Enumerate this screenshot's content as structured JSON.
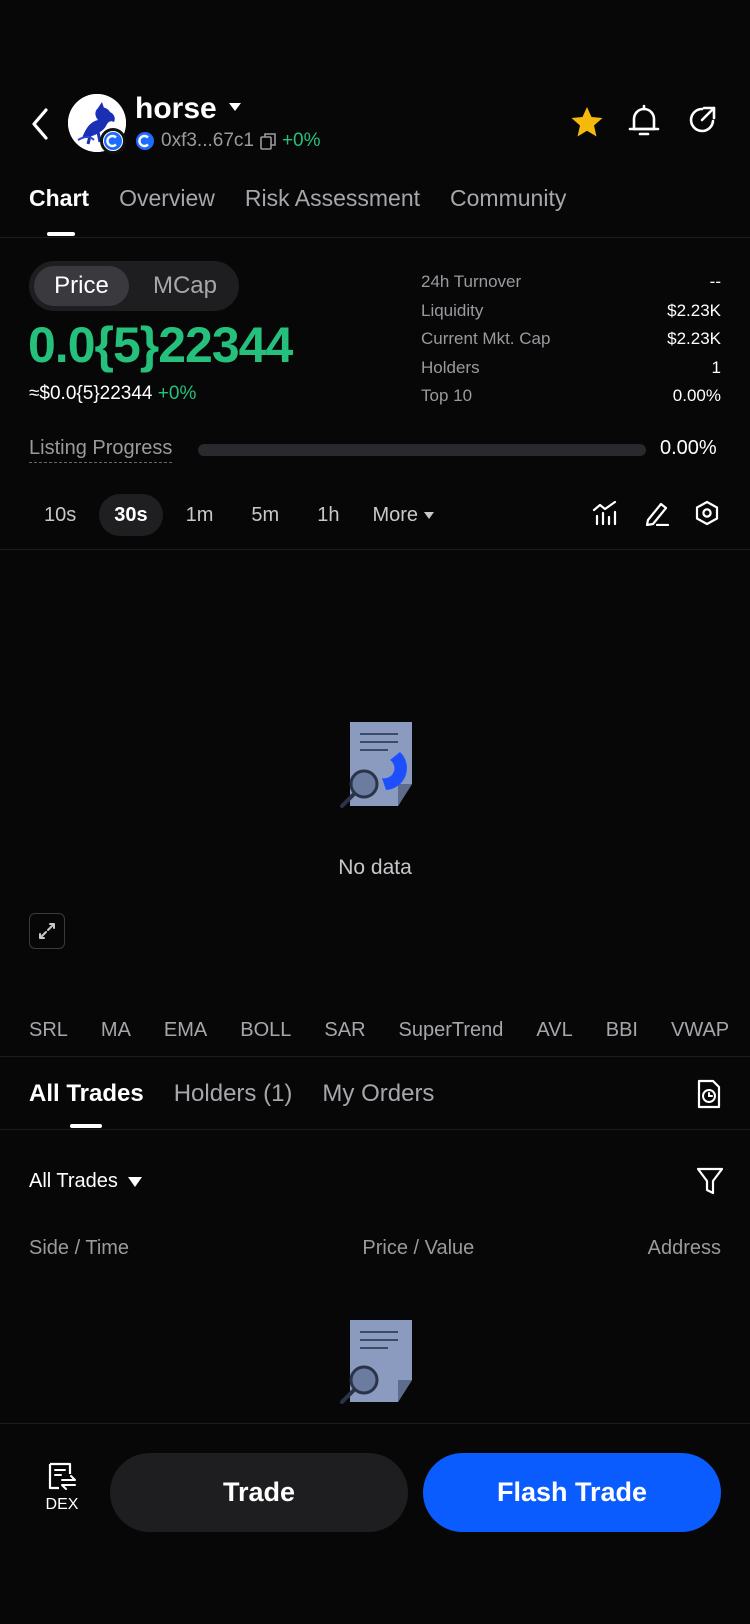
{
  "header": {
    "token_name": "horse",
    "address": "0xf3...67c1",
    "change": "+0%"
  },
  "tabs": [
    {
      "label": "Chart",
      "active": true
    },
    {
      "label": "Overview",
      "active": false
    },
    {
      "label": "Risk Assessment",
      "active": false
    },
    {
      "label": "Community",
      "active": false
    }
  ],
  "price": {
    "toggle": [
      "Price",
      "MCap"
    ],
    "value": "0.0{5}22344",
    "usd_value": "≈$0.0{5}22344",
    "usd_change": "+0%"
  },
  "stats": [
    {
      "label": "24h  Turnover",
      "value": "--"
    },
    {
      "label": "Liquidity",
      "value": "$2.23K"
    },
    {
      "label": "Current Mkt. Cap",
      "value": "$2.23K"
    },
    {
      "label": "Holders",
      "value": "1"
    },
    {
      "label": "Top 10",
      "value": "0.00%"
    }
  ],
  "listing": {
    "label": "Listing Progress",
    "value_text": "0.00%",
    "progress": 0
  },
  "timeframes": [
    "10s",
    "30s",
    "1m",
    "5m",
    "1h"
  ],
  "timeframe_active": "30s",
  "timeframe_more": "More",
  "chart": {
    "empty_text": "No data"
  },
  "indicators": [
    "SRL",
    "MA",
    "EMA",
    "BOLL",
    "SAR",
    "SuperTrend",
    "AVL",
    "BBI",
    "VWAP"
  ],
  "trade_tabs": [
    {
      "label": "All Trades",
      "active": true
    },
    {
      "label": "Holders (1)",
      "active": false
    },
    {
      "label": "My Orders",
      "active": false
    }
  ],
  "trade_filter": "All Trades",
  "columns": [
    "Side / Time",
    "Price / Value",
    "Address"
  ],
  "bottom": {
    "dex_label": "DEX",
    "trade_label": "Trade",
    "flash_label": "Flash Trade"
  },
  "colors": {
    "accent_green": "#25c07b",
    "flash_blue": "#0a5cff",
    "star": "#f5b90b",
    "background": "#070708"
  },
  "icons": [
    "back-icon",
    "caret-down-icon",
    "copy-icon",
    "star-icon",
    "bell-icon",
    "share-icon",
    "indicator-icon",
    "pen-icon",
    "settings-icon",
    "expand-icon",
    "history-icon",
    "filter-icon",
    "dex-icon"
  ]
}
